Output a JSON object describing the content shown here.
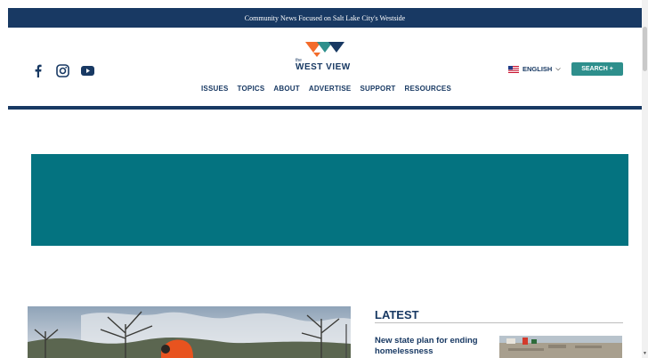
{
  "topbar": {
    "tagline": "Community News Focused on Salt Lake City's Westside"
  },
  "header": {
    "social": [
      "facebook-icon",
      "instagram-icon",
      "youtube-icon"
    ],
    "logo": {
      "the": "the",
      "name": "WEST VIEW"
    },
    "nav": [
      "ISSUES",
      "TOPICS",
      "ABOUT",
      "ADVERTISE",
      "SUPPORT",
      "RESOURCES"
    ],
    "language": {
      "label": "ENGLISH",
      "flag": "us-flag-icon"
    },
    "search_label": "SEARCH +"
  },
  "colors": {
    "navy": "#183963",
    "teal": "#2e8f8c",
    "banner": "#047380"
  },
  "latest": {
    "title": "LATEST",
    "items": [
      {
        "headline": "New state plan for ending homelessness"
      }
    ]
  }
}
